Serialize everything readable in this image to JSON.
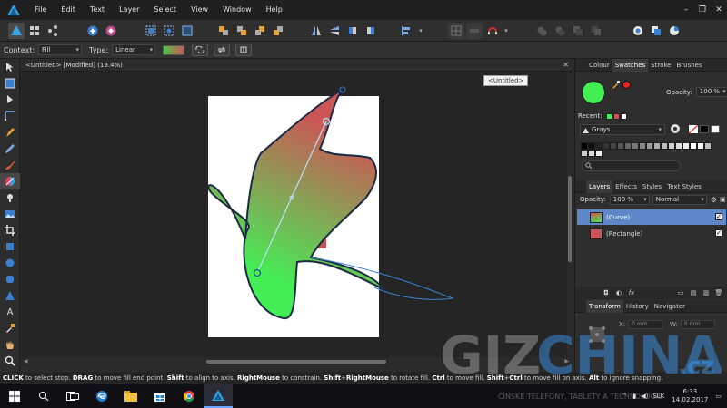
{
  "menubar": {
    "items": [
      "File",
      "Edit",
      "Text",
      "Layer",
      "Select",
      "View",
      "Window",
      "Help"
    ]
  },
  "context": {
    "label": "Context:",
    "context_value": "Fill",
    "type_label": "Type:",
    "type_value": "Linear"
  },
  "document": {
    "tab_title": "<Untitled> [Modified] (19.4%)",
    "tooltip": "<Untitled>"
  },
  "colour_panel": {
    "tabs": [
      "Colour",
      "Swatches",
      "Stroke",
      "Brushes"
    ],
    "active_tab": "Swatches",
    "opacity_label": "Opacity:",
    "opacity_value": "100 %",
    "recent_label": "Recent:",
    "palette_name": "Grays",
    "primary_color": "#44ee55",
    "secondary_color": "#ee2222"
  },
  "layers_panel": {
    "tabs": [
      "Layers",
      "Effects",
      "Styles",
      "Text Styles"
    ],
    "active_tab": "Layers",
    "opacity_label": "Opacity:",
    "opacity_value": "100 %",
    "blend_mode": "Normal",
    "layers": [
      {
        "name": "(Curve)",
        "selected": true
      },
      {
        "name": "(Rectangle)",
        "selected": false
      }
    ]
  },
  "transform_panel": {
    "tabs": [
      "Transform",
      "History",
      "Navigator"
    ],
    "active_tab": "Transform",
    "x_label": "X:",
    "x_value": "0 mm",
    "w_label": "W:",
    "w_value": "0 mm"
  },
  "statusbar": {
    "t1": "CLICK",
    "t2": " to select stop. ",
    "t3": "DRAG",
    "t4": " to move fill end point. ",
    "t5": "Shift",
    "t6": " to align to axis. ",
    "t7": "RightMouse",
    "t8": " to constrain. ",
    "t9": "Shift",
    "t10": "+",
    "t11": "RightMouse",
    "t12": " to rotate fill. ",
    "t13": "Ctrl",
    "t14": " to move fill. ",
    "t15": "Shift",
    "t16": "+",
    "t17": "Ctrl",
    "t18": " to move fill on axis. ",
    "t19": "Alt",
    "t20": " to ignore snapping."
  },
  "taskbar": {
    "language": "SLK",
    "time": "6:33",
    "date": "14.02.2017"
  },
  "watermark": {
    "text_a": "GIZ",
    "text_b": "CHINA",
    "text_c": ".cz",
    "tagline": "ČÍNSKÉ TELEFONY, TABLETY A TECHNOLOGIE"
  }
}
